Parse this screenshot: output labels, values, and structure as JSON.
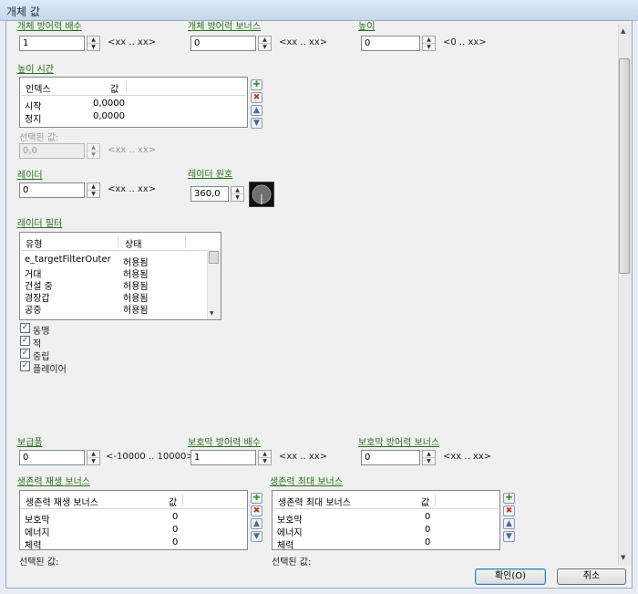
{
  "window": {
    "title": "개체 값"
  },
  "colors": {
    "label": "#2a6e1e",
    "accent": "#3c7fb1"
  },
  "row1": {
    "f1": {
      "label": "개체 방어력 배수",
      "value": "1",
      "range": "<xx .. xx>"
    },
    "f2": {
      "label": "개체 방어력 보너스",
      "value": "0",
      "range": "<xx .. xx>"
    },
    "f3": {
      "label": "높이",
      "value": "0",
      "range": "<0 .. xx>"
    }
  },
  "height_time": {
    "label": "높이 시간",
    "columns": [
      "인덱스",
      "값"
    ],
    "rows": [
      [
        "시작",
        "0,0000"
      ],
      [
        "정지",
        "0,0000"
      ]
    ],
    "selected_label": "선택된 값:",
    "selected_value": "0,0",
    "selected_range": "<xx .. xx>"
  },
  "radar": {
    "label": "레이더",
    "value": "0",
    "range": "<xx .. xx>"
  },
  "radar_circle": {
    "label": "레이더 원호",
    "value": "360,0"
  },
  "radar_filter": {
    "label": "레이더 필터",
    "columns": [
      "유형",
      "상태"
    ],
    "rows": [
      [
        "e_targetFilterOuter",
        "허용됨"
      ],
      [
        "거대",
        "허용됨"
      ],
      [
        "건설 중",
        "허용됨"
      ],
      [
        "경장갑",
        "허용됨"
      ],
      [
        "공중",
        "허용됨"
      ]
    ],
    "checks": [
      {
        "label": "동맹",
        "checked": true
      },
      {
        "label": "적",
        "checked": true
      },
      {
        "label": "중립",
        "checked": true
      },
      {
        "label": "플레이어",
        "checked": true
      }
    ]
  },
  "row2": {
    "f1": {
      "label": "보급품",
      "value": "0",
      "range": "<-10000 .. 10000>"
    },
    "f2": {
      "label": "보호막 방어력 배수",
      "value": "1",
      "range": "<xx .. xx>"
    },
    "f3": {
      "label": "보호막 방어력 보너스",
      "value": "0",
      "range": "<xx .. xx>"
    }
  },
  "life_regen": {
    "label": "생존력 재생 보너스",
    "columns": [
      "생존력 재생 보너스",
      "값"
    ],
    "rows": [
      [
        "보호막",
        "0"
      ],
      [
        "에너지",
        "0"
      ],
      [
        "체력",
        "0"
      ]
    ],
    "selected_label": "선택된 값:"
  },
  "life_max": {
    "label": "생존력 최대 보너스",
    "columns": [
      "생존력 최대 보너스",
      "값"
    ],
    "rows": [
      [
        "보호막",
        "0"
      ],
      [
        "에너지",
        "0"
      ],
      [
        "체력",
        "0"
      ]
    ],
    "selected_label": "선택된 값:"
  },
  "buttons": {
    "ok": "확인(O)",
    "cancel": "취소"
  }
}
